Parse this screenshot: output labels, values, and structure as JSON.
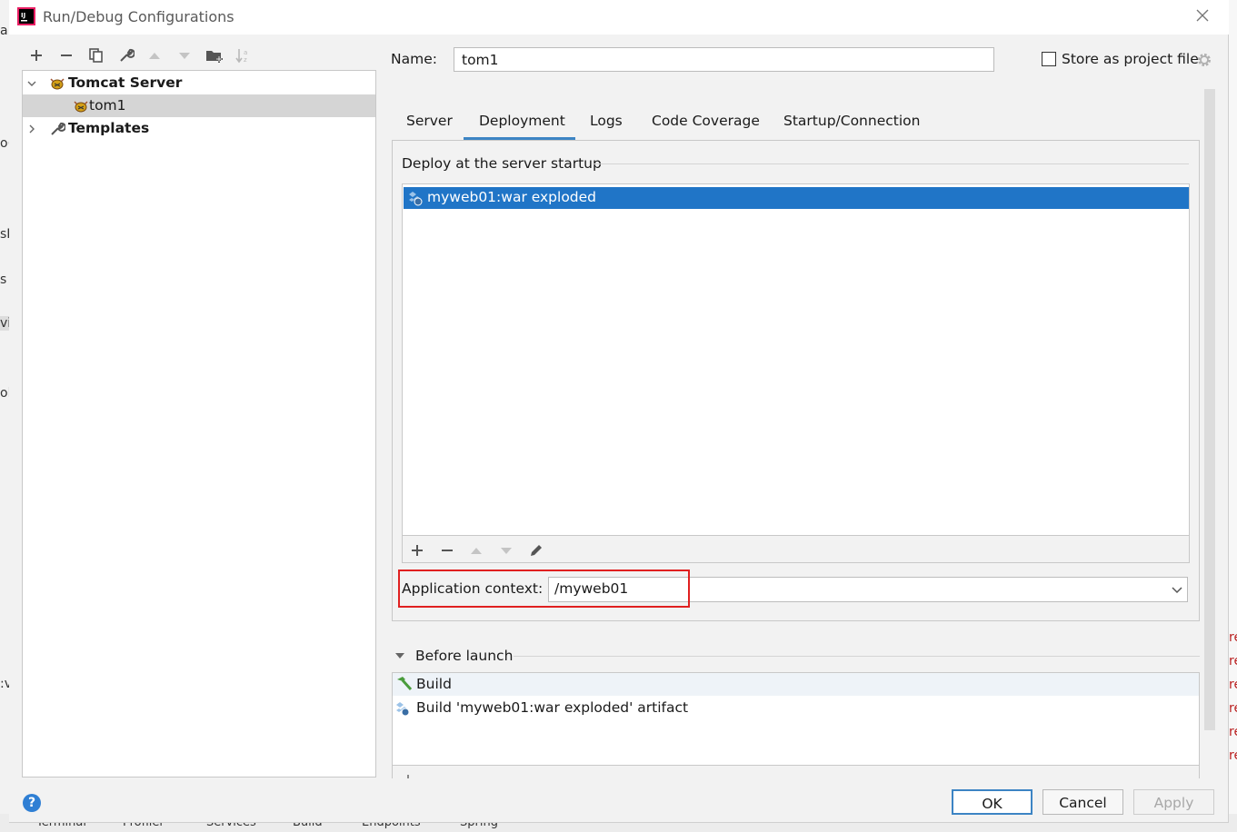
{
  "window": {
    "title": "Run/Debug Configurations"
  },
  "toolbar": {
    "icons": [
      "plus-icon",
      "minus-icon",
      "copy-icon",
      "wrench-icon",
      "arrow-up-icon",
      "arrow-down-icon",
      "new-folder-icon",
      "sort-az-icon"
    ]
  },
  "tree": {
    "items": [
      {
        "label": "Tomcat Server",
        "icon": "tomcat-icon",
        "expanded": true,
        "bold": true
      },
      {
        "label": "tom1",
        "icon": "tomcat-icon",
        "selected": true
      },
      {
        "label": "Templates",
        "icon": "wrench-icon",
        "expanded": false,
        "bold": true
      }
    ]
  },
  "config": {
    "name_label": "Name:",
    "name_value": "tom1",
    "store_label": "Store as project file",
    "store_checked": false
  },
  "tabs": [
    {
      "label": "Server"
    },
    {
      "label": "Deployment",
      "active": true
    },
    {
      "label": "Logs"
    },
    {
      "label": "Code Coverage"
    },
    {
      "label": "Startup/Connection"
    }
  ],
  "deployment": {
    "heading": "Deploy at the server startup",
    "artifacts": [
      {
        "label": "myweb01:war exploded",
        "selected": true
      }
    ],
    "context_label": "Application context:",
    "context_value": "/myweb01"
  },
  "before_launch": {
    "heading": "Before launch",
    "items": [
      {
        "label": "Build",
        "icon": "hammer-icon"
      },
      {
        "label": "Build 'myweb01:war exploded' artifact",
        "icon": "artifact-icon"
      }
    ]
  },
  "buttons": {
    "ok": "OK",
    "cancel": "Cancel",
    "apply": "Apply",
    "help": "?"
  },
  "colors": {
    "accent": "#2075c7",
    "highlight_box": "#e02020",
    "tab_underline": "#3c84c4"
  },
  "background_ide": {
    "left_fragments": [
      "a",
      "o(",
      "sD",
      "s",
      "vi",
      "ol",
      ":v"
    ],
    "right_fragments": [
      "re",
      "re",
      "re",
      "re",
      "re",
      "re"
    ],
    "bottom_tabs": [
      "Terminal",
      "Profiler",
      "Services",
      "Build",
      "Endpoints",
      "Spring"
    ]
  }
}
